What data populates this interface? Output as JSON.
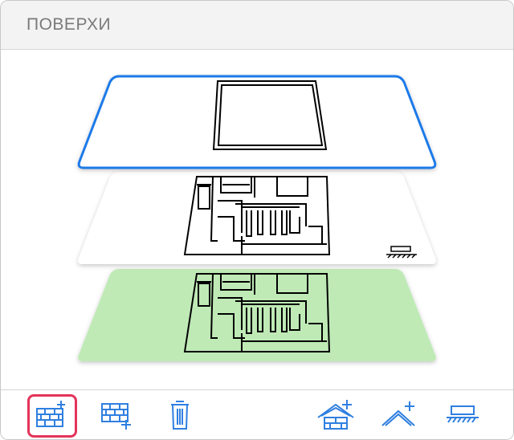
{
  "panel": {
    "title": "ПОВЕРХИ"
  },
  "colors": {
    "accent": "#1e7ae8",
    "selection": "#e3345a",
    "ground": "#bfeab6",
    "icon": "#2f7fe0"
  },
  "floors": [
    {
      "name": "roof-level",
      "selected": true
    },
    {
      "name": "floor-1",
      "selected": false
    },
    {
      "name": "ground-floor",
      "selected": false,
      "fill": "#bfeab6"
    }
  ],
  "toolbar": [
    {
      "icon": "add-floor-icon",
      "selected": true
    },
    {
      "icon": "add-floor-below-icon",
      "selected": false
    },
    {
      "icon": "trash-icon",
      "selected": false
    },
    {
      "icon": "add-roof-icon",
      "selected": false
    },
    {
      "icon": "add-roof-pitch-icon",
      "selected": false
    },
    {
      "icon": "foundation-icon",
      "selected": false
    }
  ]
}
